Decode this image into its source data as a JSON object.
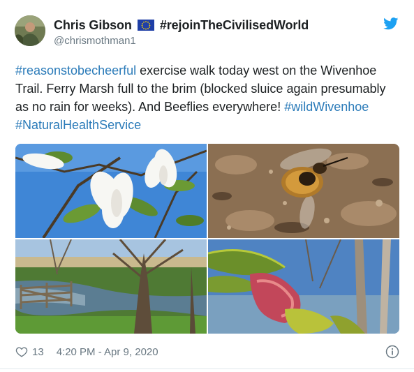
{
  "author": {
    "display_name": "Chris Gibson",
    "flag_icon": "eu-flag-icon",
    "name_suffix": "#rejoinTheCivilisedWorld",
    "handle": "@chrismothman1"
  },
  "tweet": {
    "segments": [
      {
        "text": "#reasonstobecheerful",
        "type": "hashtag"
      },
      {
        "text": " exercise walk today west on the Wivenhoe Trail. Ferry Marsh full to the brim (blocked sluice again presumably as no rain for weeks). And Beeflies everywhere! ",
        "type": "text"
      },
      {
        "text": "#wildWivenhoe",
        "type": "hashtag"
      },
      {
        "text": " ",
        "type": "text"
      },
      {
        "text": "#NaturalHealthService",
        "type": "hashtag"
      }
    ]
  },
  "media": [
    {
      "name": "magnolia-photo"
    },
    {
      "name": "beefly-photo"
    },
    {
      "name": "flooded-marsh-photo"
    },
    {
      "name": "leaf-bud-photo"
    }
  ],
  "footer": {
    "like_count": "13",
    "timestamp": "4:20 PM - Apr 9, 2020"
  },
  "colors": {
    "hashtag": "#2b7bb9",
    "twitter_blue": "#1da1f2",
    "meta_gray": "#697882"
  }
}
